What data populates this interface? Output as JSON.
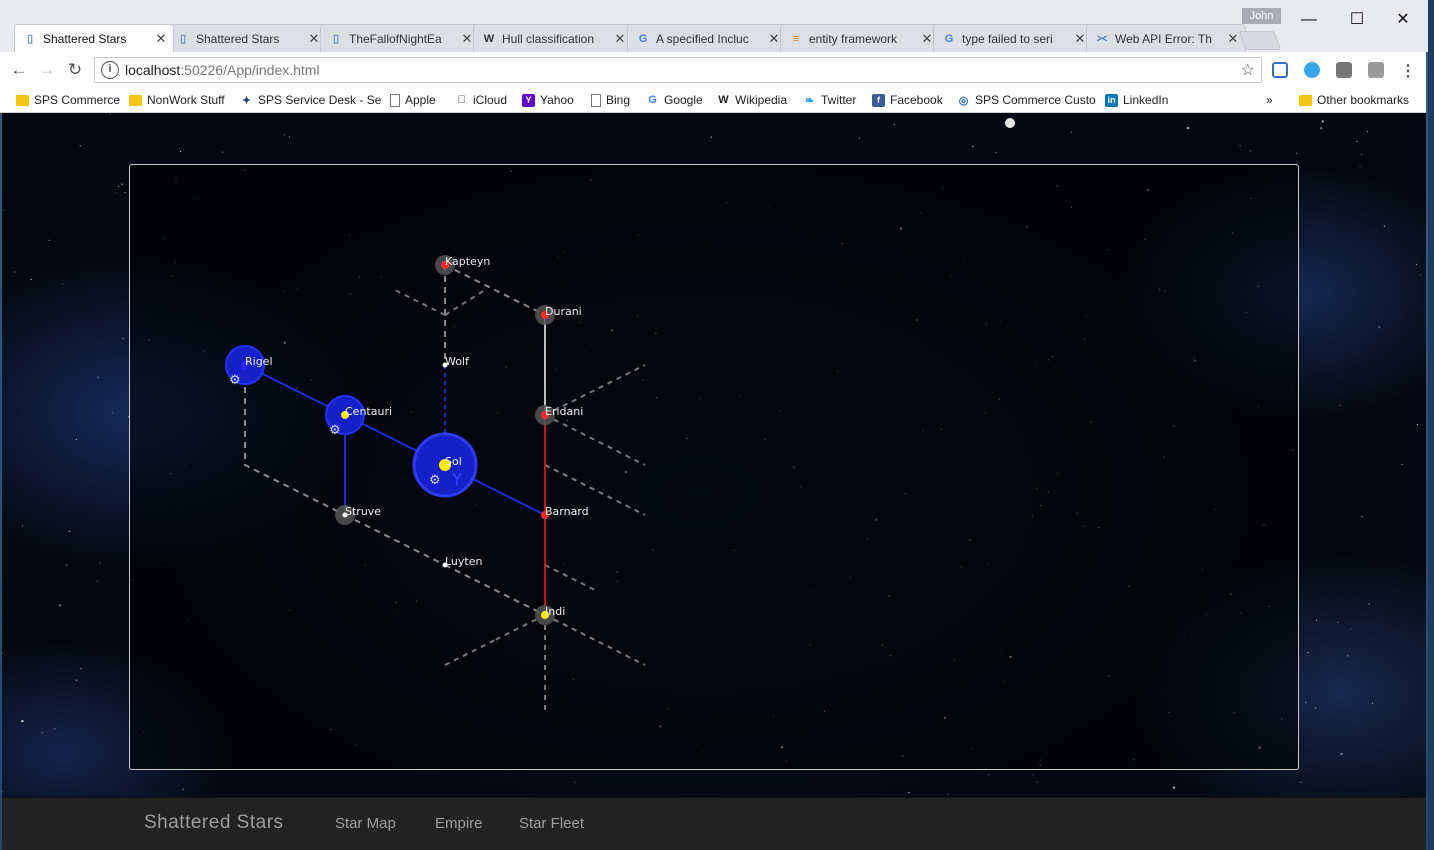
{
  "browser": {
    "user": "John",
    "tabs": [
      {
        "title": "Shattered Stars",
        "icon": "page-icon",
        "active": true
      },
      {
        "title": "Shattered Stars",
        "icon": "page-icon",
        "active": false
      },
      {
        "title": "TheFallofNightEa",
        "icon": "page-icon",
        "active": false
      },
      {
        "title": "Hull classification",
        "icon": "wikipedia-icon",
        "active": false
      },
      {
        "title": "A specified Incluc",
        "icon": "google-icon",
        "active": false
      },
      {
        "title": "entity framework",
        "icon": "stackoverflow-icon",
        "active": false
      },
      {
        "title": "type failed to seri",
        "icon": "google-icon",
        "active": false
      },
      {
        "title": "Web API Error: Th",
        "icon": "visualstudio-icon",
        "active": false
      }
    ],
    "url_host": "localhost",
    "url_path": ":50226/App/index.html",
    "bookmarks": [
      {
        "label": "SPS Commerce",
        "icon": "folder-icon"
      },
      {
        "label": "NonWork Stuff",
        "icon": "folder-icon"
      },
      {
        "label": "SPS Service Desk - Se",
        "icon": "servicedesk-icon"
      },
      {
        "label": "Apple",
        "icon": "page-icon"
      },
      {
        "label": "iCloud",
        "icon": "apple-icon"
      },
      {
        "label": "Yahoo",
        "icon": "yahoo-icon"
      },
      {
        "label": "Bing",
        "icon": "page-icon"
      },
      {
        "label": "Google",
        "icon": "google-icon"
      },
      {
        "label": "Wikipedia",
        "icon": "wikipedia-icon"
      },
      {
        "label": "Twitter",
        "icon": "twitter-icon"
      },
      {
        "label": "Facebook",
        "icon": "facebook-icon"
      },
      {
        "label": "SPS Commerce Custo",
        "icon": "sps-icon"
      },
      {
        "label": "LinkedIn",
        "icon": "linkedin-icon"
      }
    ],
    "bookmarks_overflow": "»",
    "other_bookmarks": "Other bookmarks"
  },
  "app": {
    "brand": "Shattered Stars",
    "nav": [
      "Star Map",
      "Empire",
      "Star Fleet"
    ]
  },
  "starmap": {
    "systems": [
      {
        "name": "Kapteyn",
        "col": 2,
        "row": 0,
        "color": "#ff2a2a",
        "halo": "gray",
        "fleet": false
      },
      {
        "name": "Durani",
        "col": 3,
        "row": 1,
        "color": "#ff2a2a",
        "halo": "gray",
        "fleet": false
      },
      {
        "name": "Rigel",
        "col": 0,
        "row": 2,
        "color": "#2a2aff",
        "halo": "blue",
        "fleet": true
      },
      {
        "name": "Wolf",
        "col": 2,
        "row": 2,
        "color": "#ffffff",
        "halo": "none",
        "fleet": false
      },
      {
        "name": "Centauri",
        "col": 1,
        "row": 3,
        "color": "#ffee00",
        "halo": "blue",
        "fleet": true
      },
      {
        "name": "Eridani",
        "col": 3,
        "row": 3,
        "color": "#ff2a2a",
        "halo": "gray",
        "fleet": false
      },
      {
        "name": "Sol",
        "col": 2,
        "row": 4,
        "color": "#ffee00",
        "halo": "blue-large",
        "fleet": true
      },
      {
        "name": "Struve",
        "col": 1,
        "row": 5,
        "color": "#ffffff",
        "halo": "gray",
        "fleet": false
      },
      {
        "name": "Barnard",
        "col": 3,
        "row": 5,
        "color": "#ff2a2a",
        "halo": "none",
        "fleet": false
      },
      {
        "name": "Luyten",
        "col": 2,
        "row": 6,
        "color": "#ffffff",
        "halo": "none",
        "fleet": false
      },
      {
        "name": "Indi",
        "col": 3,
        "row": 7,
        "color": "#ffee00",
        "halo": "gray",
        "fleet": false
      }
    ],
    "lanes": [
      {
        "from": "Kapteyn",
        "to": "Durani",
        "style": "dashed-gray"
      },
      {
        "from": "Kapteyn",
        "to": "Wolf",
        "style": "dashed-gray"
      },
      {
        "from": "Durani",
        "to": "Eridani",
        "style": "solid-gray"
      },
      {
        "from": "Rigel",
        "to": "Centauri",
        "style": "solid-blue"
      },
      {
        "from": "Rigel",
        "to": "Struve",
        "style": "dashed-gray-path"
      },
      {
        "from": "Wolf",
        "to": "Sol",
        "style": "dashed-blue"
      },
      {
        "from": "Centauri",
        "to": "Sol",
        "style": "solid-blue"
      },
      {
        "from": "Centauri",
        "to": "Struve",
        "style": "solid-blue"
      },
      {
        "from": "Sol",
        "to": "Barnard",
        "style": "solid-blue"
      },
      {
        "from": "Eridani",
        "to": "Barnard",
        "style": "solid-red"
      },
      {
        "from": "Barnard",
        "to": "Indi",
        "style": "solid-red"
      },
      {
        "from": "Struve",
        "to": "Luyten",
        "style": "dashed-gray"
      },
      {
        "from": "Luyten",
        "to": "Indi",
        "style": "dashed-gray"
      }
    ]
  }
}
